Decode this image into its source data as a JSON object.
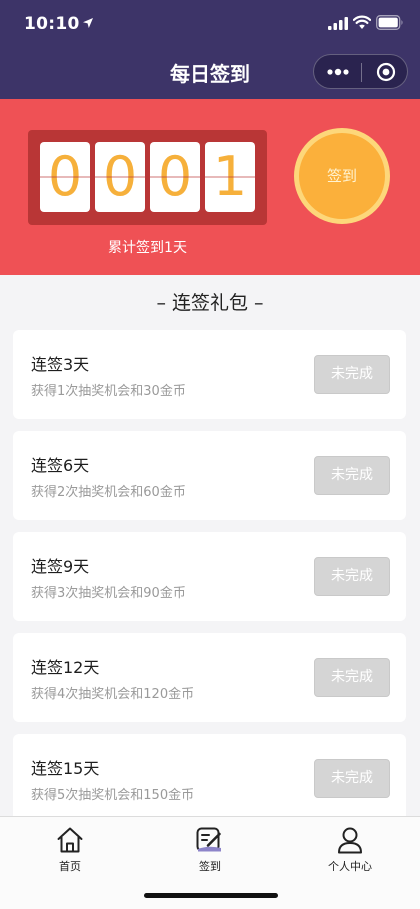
{
  "status_bar": {
    "time": "10:10"
  },
  "nav": {
    "title": "每日签到"
  },
  "counter": {
    "digits": [
      "0",
      "0",
      "0",
      "1"
    ],
    "total_text": "累计签到1天",
    "signin_label": "签到"
  },
  "section": {
    "title": "– 连签礼包 –"
  },
  "rewards": [
    {
      "title": "连签3天",
      "desc": "获得1次抽奖机会和30金币",
      "button": "未完成"
    },
    {
      "title": "连签6天",
      "desc": "获得2次抽奖机会和60金币",
      "button": "未完成"
    },
    {
      "title": "连签9天",
      "desc": "获得3次抽奖机会和90金币",
      "button": "未完成"
    },
    {
      "title": "连签12天",
      "desc": "获得4次抽奖机会和120金币",
      "button": "未完成"
    },
    {
      "title": "连签15天",
      "desc": "获得5次抽奖机会和150金币",
      "button": "未完成"
    }
  ],
  "tabs": [
    {
      "label": "首页",
      "icon": "home-icon"
    },
    {
      "label": "签到",
      "icon": "checkin-icon",
      "active": true
    },
    {
      "label": "个人中心",
      "icon": "user-icon"
    }
  ],
  "colors": {
    "header": "#3d3468",
    "hero": "#ef5155",
    "counter_box": "#b93636",
    "digit": "#f6b03b",
    "signin_button": "#fbb03b",
    "disabled_button": "#d5d5d5"
  }
}
